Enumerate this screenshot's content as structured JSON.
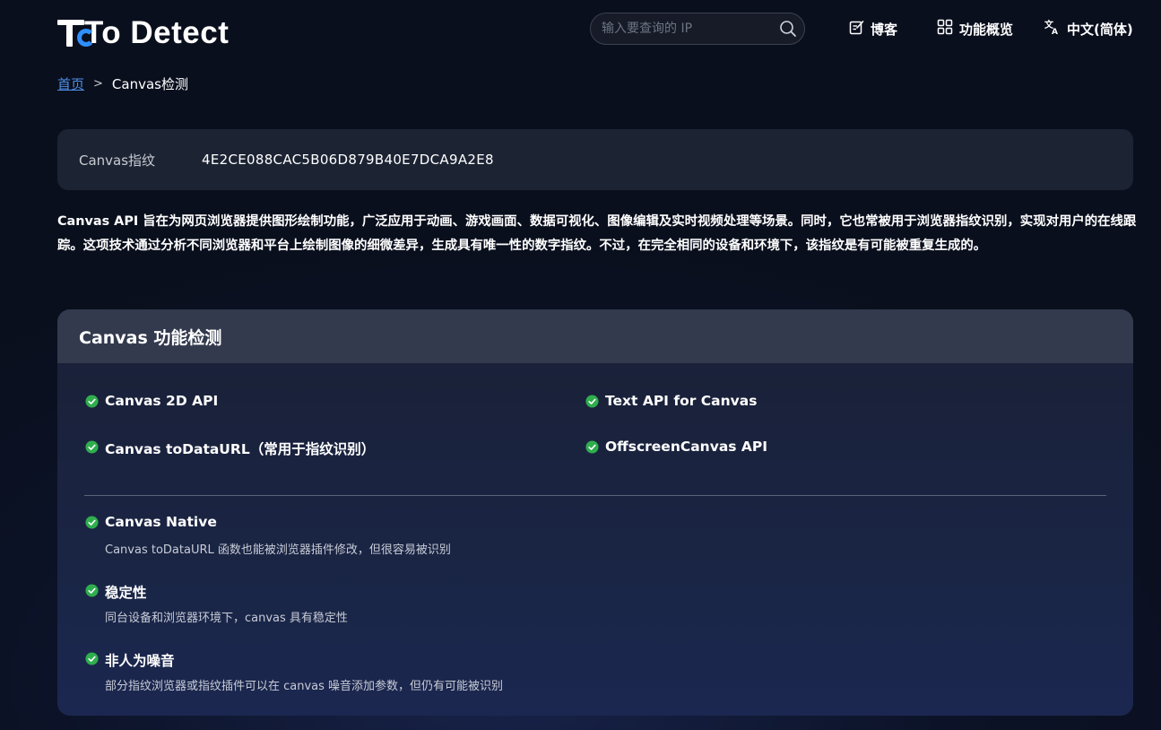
{
  "header": {
    "logo_text": "To Detect",
    "search_placeholder": "输入要查询的 IP",
    "nav": {
      "blog": "博客",
      "features": "功能概览",
      "language": "中文(简体)"
    }
  },
  "breadcrumb": {
    "home": "首页",
    "separator": ">",
    "current": "Canvas检测"
  },
  "fingerprint": {
    "label": "Canvas指纹",
    "value": "4E2CE088CAC5B06D879B40E7DCA9A2E8"
  },
  "description": "Canvas API 旨在为网页浏览器提供图形绘制功能，广泛应用于动画、游戏画面、数据可视化、图像编辑及实时视频处理等场景。同时，它也常被用于浏览器指纹识别，实现对用户的在线跟踪。这项技术通过分析不同浏览器和平台上绘制图像的细微差异，生成具有唯一性的数字指纹。不过，在完全相同的设备和环境下，该指纹是有可能被重复生成的。",
  "panel": {
    "title": "Canvas 功能检测",
    "features": [
      {
        "label": "Canvas 2D API",
        "status": "pass"
      },
      {
        "label": "Text API for Canvas",
        "status": "pass"
      },
      {
        "label": "Canvas toDataURL（常用于指纹识别）",
        "status": "pass"
      },
      {
        "label": "OffscreenCanvas API",
        "status": "pass"
      }
    ],
    "details": [
      {
        "label": "Canvas Native",
        "desc": "Canvas toDataURL 函数也能被浏览器插件修改，但很容易被识别",
        "status": "pass"
      },
      {
        "label": "稳定性",
        "desc": "同台设备和浏览器环境下，canvas 具有稳定性",
        "status": "pass"
      },
      {
        "label": "非人为噪音",
        "desc": "部分指纹浏览器或指纹插件可以在 canvas 噪音添加参数，但仍有可能被识别",
        "status": "pass"
      }
    ]
  },
  "colors": {
    "accent_blue": "#2f8fff",
    "link": "#4f8fe6",
    "check_green": "#2fae4e",
    "card_bg": "#1c2333",
    "panel_header_bg": "#333a4e"
  }
}
